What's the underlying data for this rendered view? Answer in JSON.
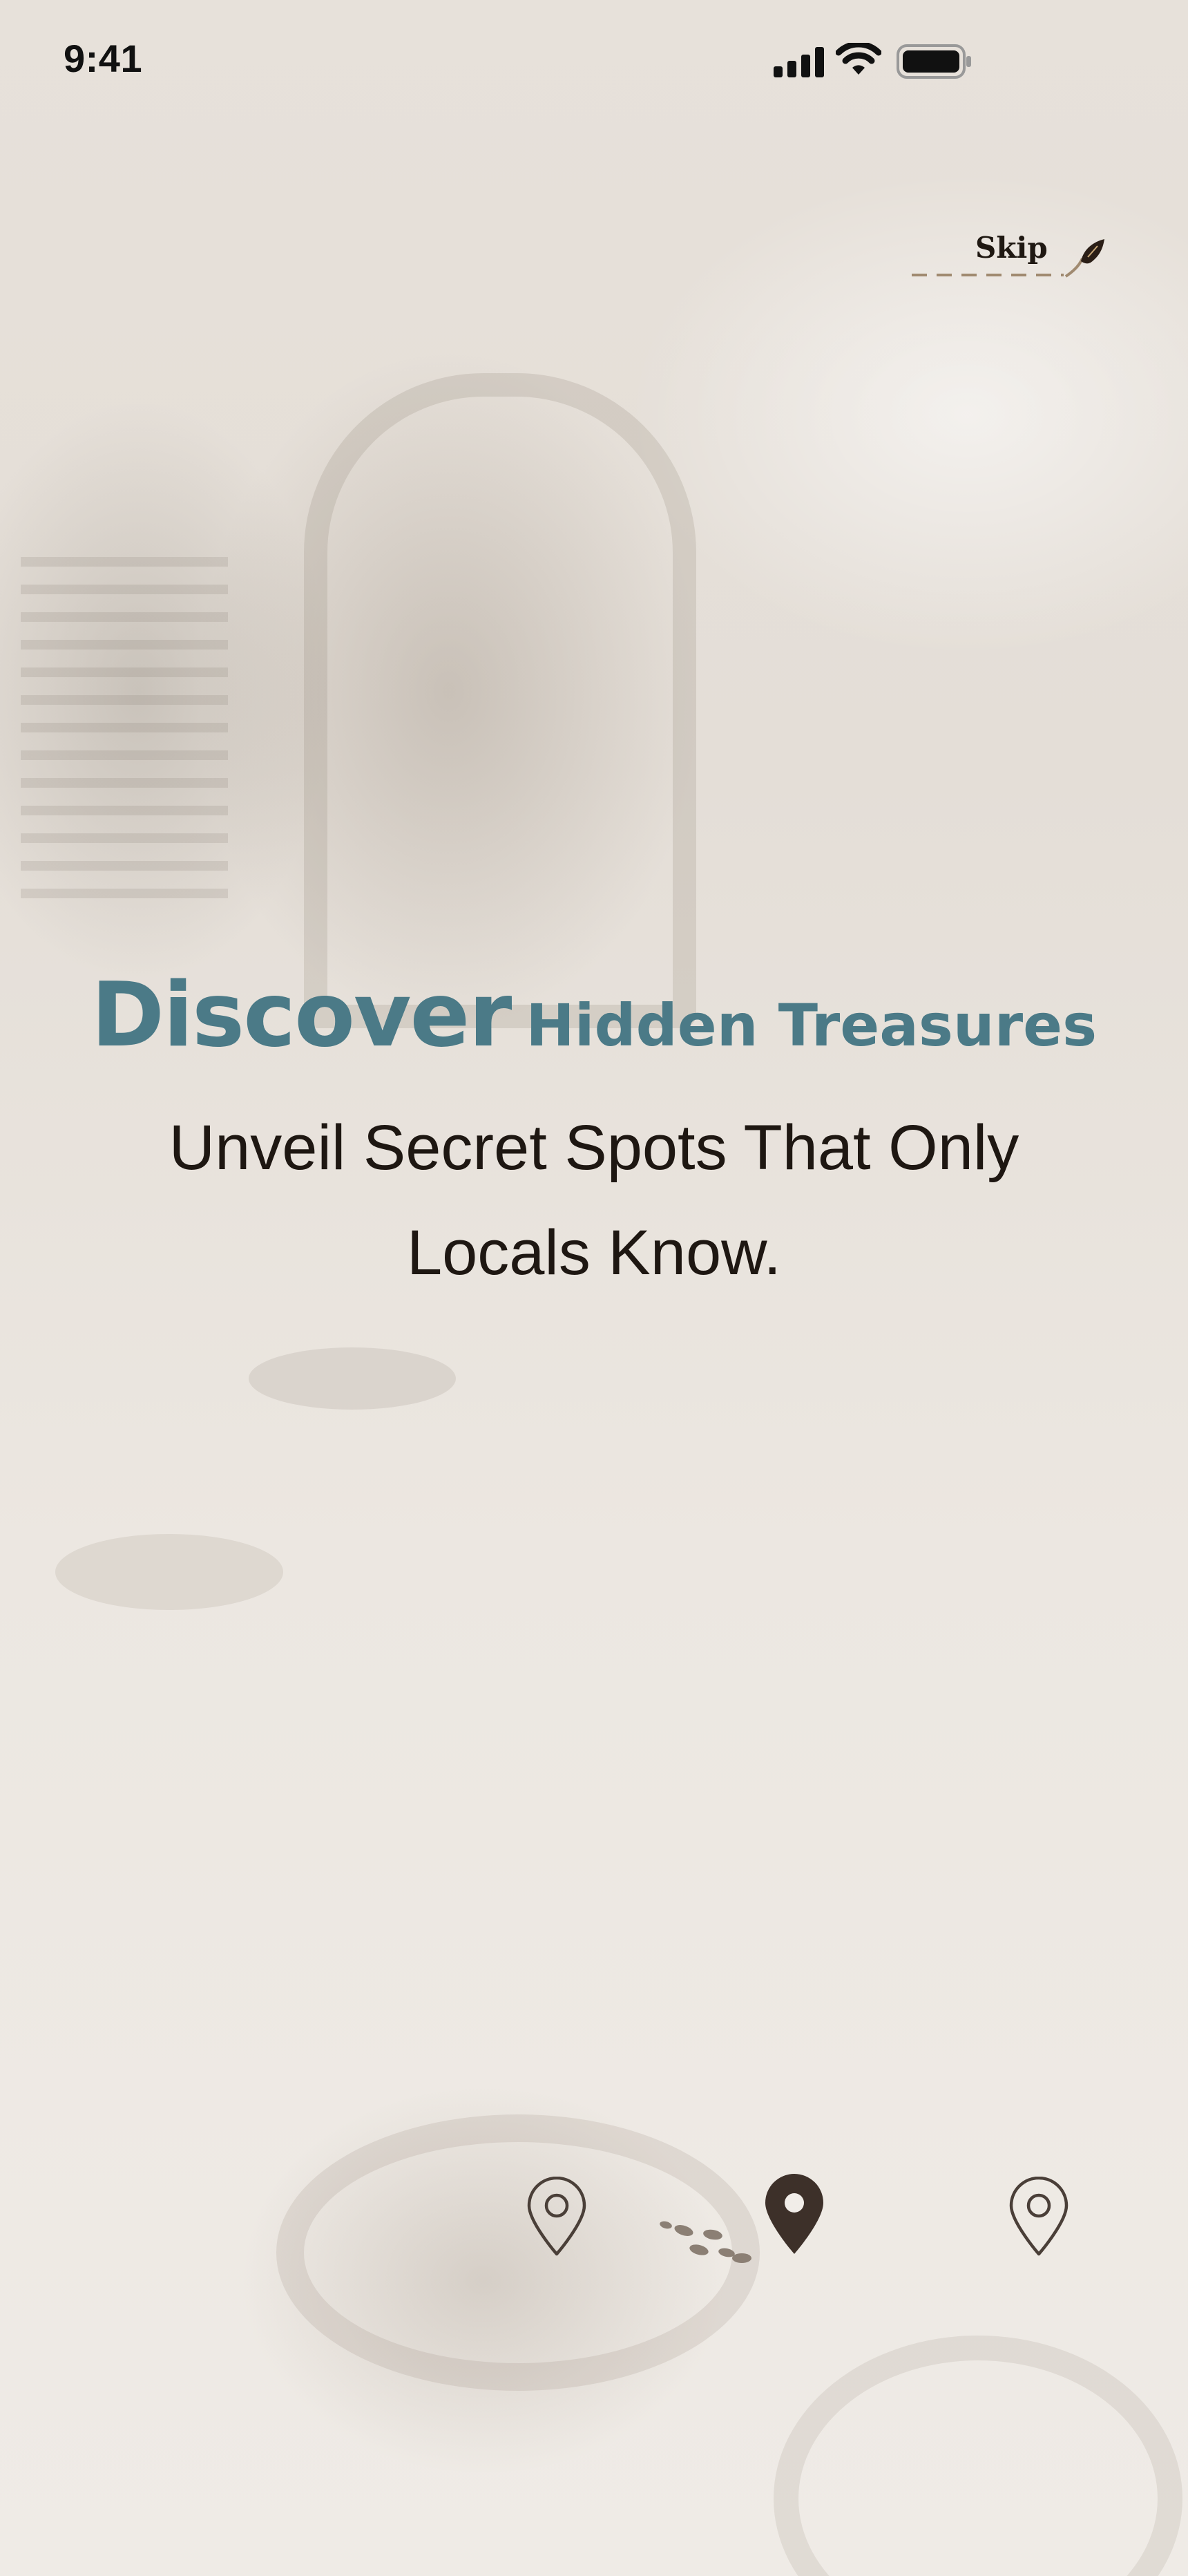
{
  "status_bar": {
    "time": "9:41",
    "icons": [
      "signal-icon",
      "wifi-icon",
      "battery-icon"
    ]
  },
  "skip": {
    "label": "Skip",
    "icon": "feather-icon"
  },
  "onboarding": {
    "headline_big": "Discover",
    "headline_small": "Hidden Treasures",
    "subheadline": "Unveil Secret Spots That Only Locals Know."
  },
  "pager": {
    "total_pages": 3,
    "active_index": 1,
    "icons": [
      "map-pin-outline-icon",
      "map-pin-filled-icon",
      "map-pin-outline-icon"
    ]
  },
  "colors": {
    "accent": "#4b7a87",
    "text_dark": "#1e1712",
    "pin_active": "#3d3029",
    "pin_inactive": "#4a3f38",
    "background": "#e8e2db"
  }
}
